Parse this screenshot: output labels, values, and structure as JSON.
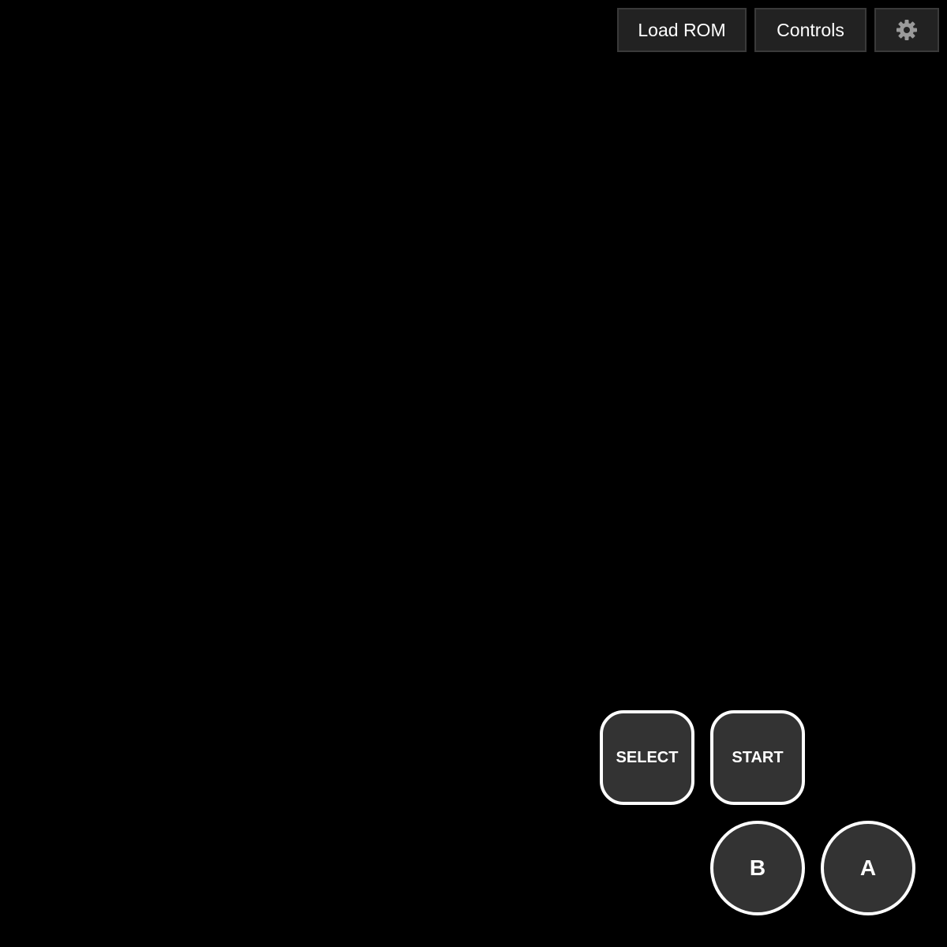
{
  "toolbar": {
    "load_rom_label": "Load ROM",
    "controls_label": "Controls",
    "settings_icon": "gear-icon"
  },
  "gamepad": {
    "select_label": "SELECT",
    "start_label": "START",
    "b_label": "B",
    "a_label": "A"
  },
  "colors": {
    "background": "#000000",
    "toolbar_button_bg": "#222222",
    "toolbar_button_border": "#3a3a3a",
    "pad_button_bg": "#333333",
    "pad_button_border": "#ffffff",
    "gear_icon": "#9a9a9a",
    "text": "#ffffff"
  }
}
